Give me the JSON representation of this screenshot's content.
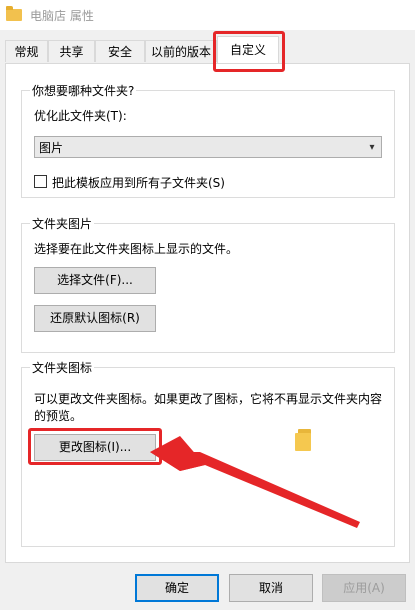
{
  "window": {
    "title": "电脑店 属性"
  },
  "tabs": [
    {
      "label": "常规"
    },
    {
      "label": "共享"
    },
    {
      "label": "安全"
    },
    {
      "label": "以前的版本"
    },
    {
      "label": "自定义"
    }
  ],
  "group_folder_type": {
    "label": "你想要哪种文件夹?",
    "optimize_label": "优化此文件夹(T):",
    "select_value": "图片",
    "checkbox_label": "把此模板应用到所有子文件夹(S)",
    "checkbox_checked": false
  },
  "group_folder_picture": {
    "label": "文件夹图片",
    "description": "选择要在此文件夹图标上显示的文件。",
    "choose_file_button": "选择文件(F)...",
    "restore_default_button": "还原默认图标(R)"
  },
  "group_folder_icon": {
    "label": "文件夹图标",
    "description_line1": "可以更改文件夹图标。如果更改了图标，它将不再显示文件夹内容",
    "description_line2": "的预览。",
    "change_icon_button": "更改图标(I)..."
  },
  "footer": {
    "ok": "确定",
    "cancel": "取消",
    "apply": "应用(A)"
  },
  "colors": {
    "annotation": "#e52628",
    "folder": "#f5c84f",
    "default_button_border": "#0078d7"
  },
  "icons": {
    "title_icon": "folder-icon",
    "preview_icon": "folder-preview-icon"
  }
}
